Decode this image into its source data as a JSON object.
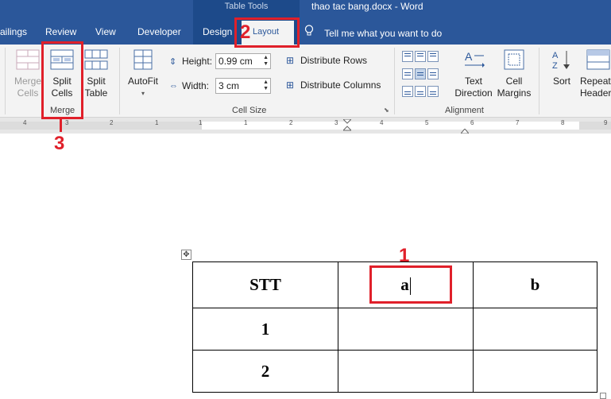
{
  "titlebar": {
    "contextual_label": "Table Tools",
    "document_title": "thao tac bang.docx  -  Word",
    "tabs": [
      "ailings",
      "Review",
      "View",
      "Developer",
      "Design",
      "Layout"
    ],
    "tell_me": "Tell me what you want to do"
  },
  "ribbon": {
    "merge_group": {
      "label": "Merge",
      "merge_cells": "Merge Cells",
      "split_cells": "Split Cells",
      "split_table": "Split Table"
    },
    "autofit": "AutoFit",
    "cell_size": {
      "label": "Cell Size",
      "height_label": "Height:",
      "height_value": "0.99 cm",
      "width_label": "Width:",
      "width_value": "3 cm",
      "distribute_rows": "Distribute Rows",
      "distribute_columns": "Distribute Columns"
    },
    "alignment": {
      "label": "Alignment",
      "text_direction": "Text Direction",
      "cell_margins": "Cell Margins",
      "selected_index": 4
    },
    "sort": "Sort",
    "repeat_header": "Repeat Header"
  },
  "ruler": {
    "numbers": [
      "4",
      "3",
      "2",
      "1",
      "1",
      "1",
      "2",
      "3",
      "4",
      "5",
      "6",
      "7",
      "8",
      "9"
    ]
  },
  "table": {
    "rows": [
      [
        "STT",
        "a",
        "b"
      ],
      [
        "1",
        "",
        ""
      ],
      [
        "2",
        "",
        ""
      ]
    ]
  },
  "annotations": {
    "labels": [
      "1",
      "2",
      "3"
    ],
    "color": "#e0202a"
  }
}
